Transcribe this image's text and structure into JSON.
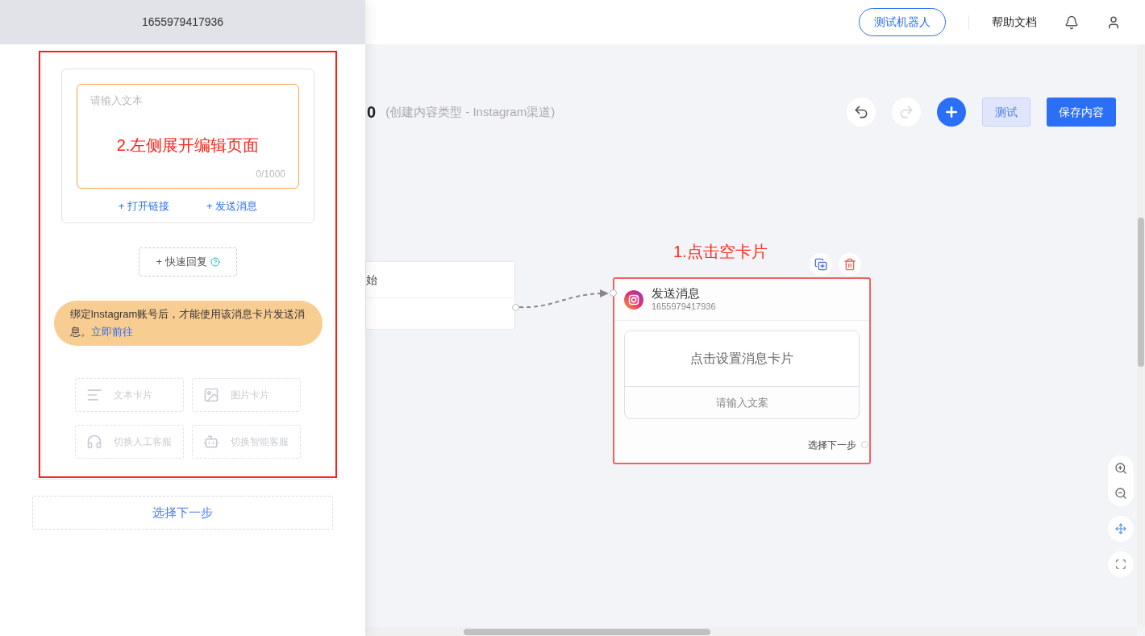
{
  "top_bar": {
    "test_bot_button": "测试机器人",
    "help_link": "帮助文档"
  },
  "editor_panel": {
    "title": "1655979417936",
    "text_field": {
      "placeholder": "请输入文本",
      "counter": "0/1000"
    },
    "text_actions": [
      "+ 打开链接",
      "+ 发送消息"
    ],
    "quick_reply": "+ 快速回复",
    "notice": {
      "text": "绑定Instagram账号后，才能使用该消息卡片发送消息。",
      "link": "立即前往"
    },
    "card_types": [
      {
        "kind": "text",
        "label": "文本卡片",
        "disabled": true
      },
      {
        "kind": "image",
        "label": "图片卡片",
        "disabled": true
      },
      {
        "kind": "human",
        "label": "切换人工客服",
        "disabled": true
      },
      {
        "kind": "bot",
        "label": "切换智能客服",
        "disabled": true
      }
    ],
    "next_step_button": "选择下一步"
  },
  "annotations": [
    {
      "text": "2.左侧展开编辑页面"
    },
    {
      "text": "1.点击空卡片"
    }
  ],
  "canvas": {
    "title": "0",
    "subtitle": "(创建内容类型 - Instagram渠道)",
    "toolbar": [
      {
        "kind": "undo",
        "disabled": false
      },
      {
        "kind": "redo",
        "disabled": true
      },
      {
        "kind": "add"
      }
    ],
    "test_button": "测试",
    "save_button": "保存内容",
    "start_node": {
      "title": "始"
    },
    "message_node": {
      "title": "发送消息",
      "id": "1655979417936",
      "selected": true,
      "card_prompt": "点击设置消息卡片",
      "copy_placeholder": "请输入文案",
      "next_step": "选择下一步"
    }
  }
}
